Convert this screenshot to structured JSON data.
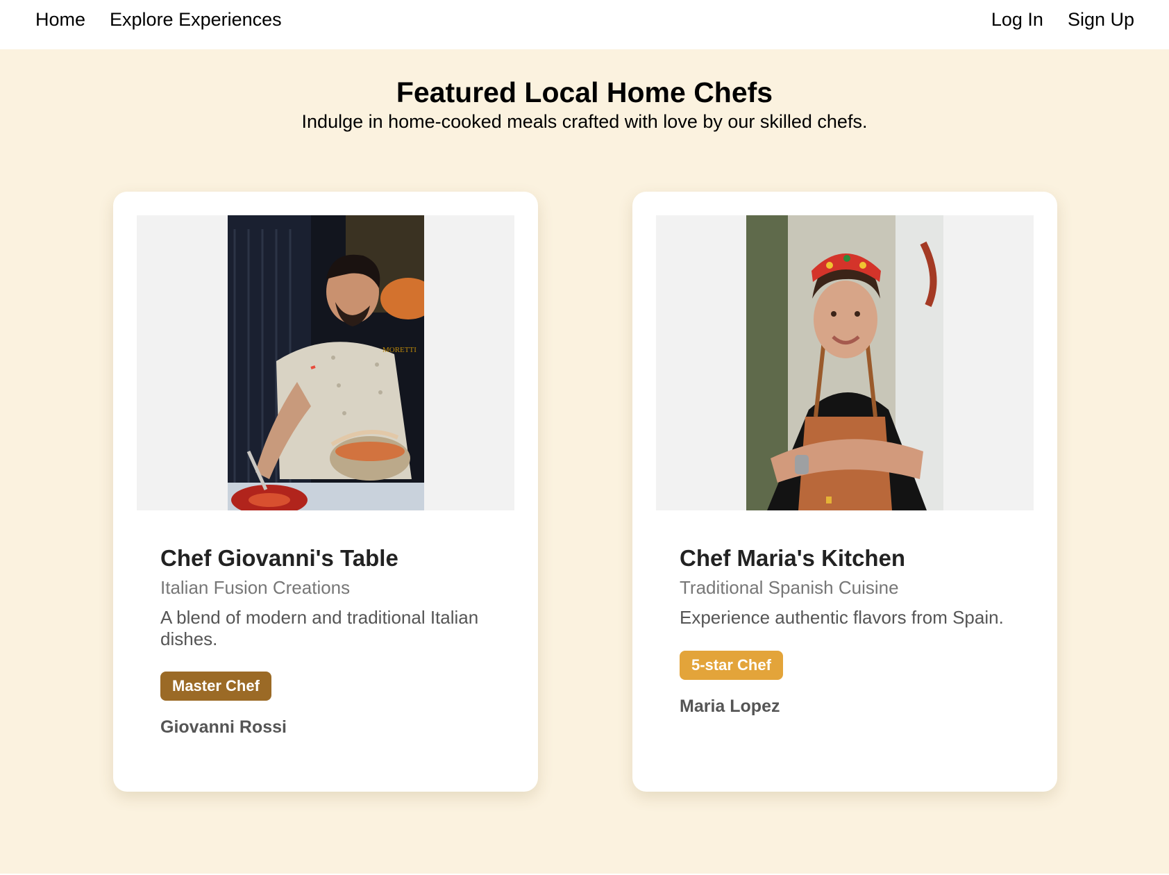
{
  "nav": {
    "home": "Home",
    "explore": "Explore Experiences",
    "login": "Log In",
    "signup": "Sign Up"
  },
  "hero": {
    "title": "Featured Local Home Chefs",
    "subtitle": "Indulge in home-cooked meals crafted with love by our skilled chefs."
  },
  "chefs": [
    {
      "title": "Chef Giovanni's Table",
      "cuisine": "Italian Fusion Creations",
      "description": "A blend of modern and traditional Italian dishes.",
      "badge": "Master Chef",
      "name": "Giovanni Rossi",
      "jacket_text": "MORETTI"
    },
    {
      "title": "Chef Maria's Kitchen",
      "cuisine": "Traditional Spanish Cuisine",
      "description": "Experience authentic flavors from Spain.",
      "badge": "5-star Chef",
      "name": "Maria Lopez"
    }
  ],
  "colors": {
    "page_background": "#fbf2df",
    "badge_master": "#9b6a26",
    "badge_star": "#e3a43a"
  }
}
